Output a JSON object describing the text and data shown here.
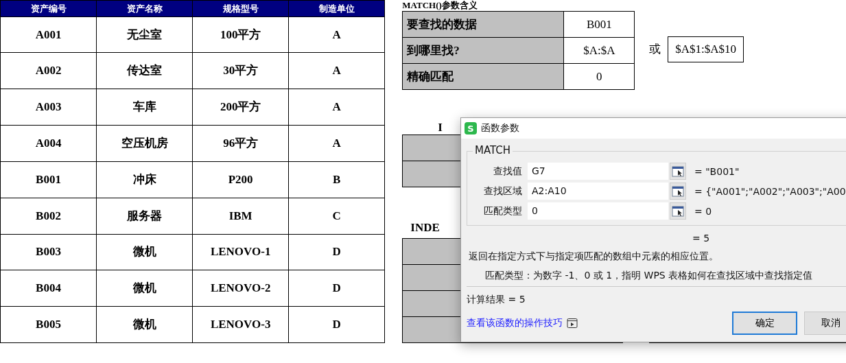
{
  "asset_table": {
    "columns": [
      "资产编号",
      "资产名称",
      "规格型号",
      "制造单位"
    ],
    "rows": [
      [
        "A001",
        "无尘室",
        "100平方",
        "A"
      ],
      [
        "A002",
        "传达室",
        "30平方",
        "A"
      ],
      [
        "A003",
        "车库",
        "200平方",
        "A"
      ],
      [
        "A004",
        "空压机房",
        "96平方",
        "A"
      ],
      [
        "B001",
        "冲床",
        "P200",
        "B"
      ],
      [
        "B002",
        "服务器",
        "IBM",
        "C"
      ],
      [
        "B003",
        "微机",
        "LENOVO-1",
        "D"
      ],
      [
        "B004",
        "微机",
        "LENOVO-2",
        "D"
      ],
      [
        "B005",
        "微机",
        "LENOVO-3",
        "D"
      ]
    ]
  },
  "match_section": {
    "title": "MATCH()参数含义",
    "rows": [
      {
        "label": "要查找的数据",
        "value": "B001"
      },
      {
        "label": "到哪里找?",
        "value": "$A:$A"
      },
      {
        "label": "精确匹配",
        "value": "0"
      }
    ],
    "or_text": "或",
    "alt_value": "$A$1:$A$10"
  },
  "second_section": {
    "title": "I"
  },
  "third_section": {
    "title": "INDE"
  },
  "dialog": {
    "logo": "S",
    "title": "函数参数",
    "function_name": "MATCH",
    "args": [
      {
        "label": "查找值",
        "value": "G7",
        "result": "= \"B001\""
      },
      {
        "label": "查找区域",
        "value": "A2:A10",
        "result": "= {\"A001\";\"A002\";\"A003\";\"A00"
      },
      {
        "label": "匹配类型",
        "value": "0",
        "result": "= 0"
      }
    ],
    "formula_result": "= 5",
    "description": "返回在指定方式下与指定项匹配的数组中元素的相应位置。",
    "arg_help": "匹配类型：为数字 -1、0 或 1，指明 WPS 表格如何在查找区域中查找指定值",
    "calc_result": "计算结果 = 5",
    "help_link": "查看该函数的操作技巧",
    "buttons": [
      {
        "label": "确定",
        "default": true
      },
      {
        "label": "取消",
        "default": false
      }
    ]
  }
}
